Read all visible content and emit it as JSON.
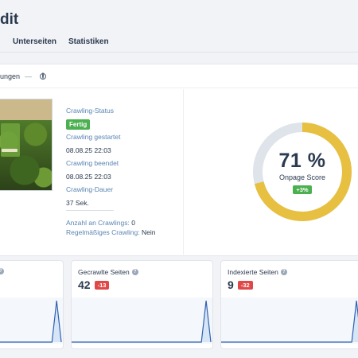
{
  "page": {
    "title": "dit"
  },
  "tabs": [
    {
      "label": "Unterseiten"
    },
    {
      "label": "Statistiken"
    }
  ],
  "breadcrumb": {
    "text": "ungen",
    "separator": "—",
    "icon": "globe-icon"
  },
  "crawl": {
    "status_label": "Crawling-Status",
    "status_value": "Fertig",
    "started_label": "Crawling gestartet",
    "started_value": "08.08.25 22:03",
    "ended_label": "Crawling beendet",
    "ended_value": "08.08.25 22:03",
    "duration_label": "Crawling-Dauer",
    "duration_value": "37 Sek.",
    "count_label": "Anzahl an Crawlings:",
    "count_value": "0",
    "regular_label": "Regelmäßiges Crawling:",
    "regular_value": "Nein"
  },
  "score": {
    "value_text": "71 %",
    "value": 71,
    "label": "Onpage Score",
    "delta": "+3%"
  },
  "colors": {
    "accent": "#e7c042",
    "track": "#dfe3ea",
    "positive": "#4caf50",
    "negative": "#e04848",
    "chart_line": "#2f5fb0",
    "chart_fill": "#d6e6f7"
  },
  "stats": [
    {
      "title": "",
      "value": "",
      "delta": ""
    },
    {
      "title": "Gecrawlte Seiten",
      "value": "42",
      "delta": "-13"
    },
    {
      "title": "Indexierte Seiten",
      "value": "9",
      "delta": "-32"
    }
  ]
}
